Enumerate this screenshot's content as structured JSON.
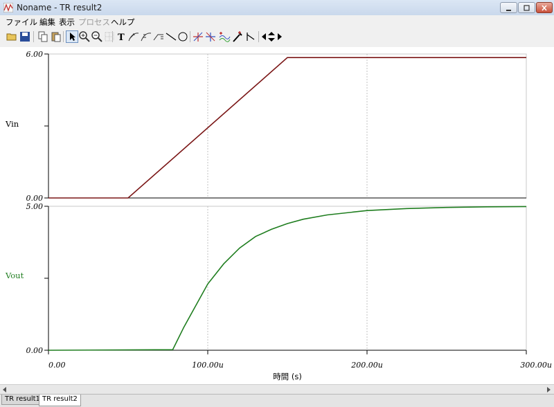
{
  "window": {
    "title": "Noname - TR result2",
    "icon": "app-waveform-icon"
  },
  "menu": [
    {
      "label": "ファイル",
      "enabled": true
    },
    {
      "label": "編集",
      "enabled": true
    },
    {
      "label": "表示",
      "enabled": true
    },
    {
      "label": "プロセス",
      "enabled": false
    },
    {
      "label": "ヘルプ",
      "enabled": true
    }
  ],
  "toolbar": {
    "icons": [
      "open-folder-icon",
      "save-disk-icon",
      "copy-icon",
      "paste-icon",
      "grid-icon",
      "pointer-icon",
      "zoom-in-icon",
      "zoom-fit-icon",
      "text-icon",
      "measure-icon",
      "measure-diff-icon",
      "measure-slope-icon",
      "line-icon",
      "circle-icon",
      "marker-a-icon",
      "marker-b-icon",
      "add-trace-icon",
      "probe-icon",
      "cursor-icon",
      "scroll-left-icon",
      "scroll-updown-icon",
      "scroll-right-icon"
    ]
  },
  "chart_data": [
    {
      "type": "line",
      "ylabel": "Vin",
      "ylim": [
        0,
        6
      ],
      "ytick_labels": [
        "6.00",
        "0.00"
      ],
      "color": "#7a1515",
      "series": [
        {
          "x": [
            0,
            50,
            150,
            300
          ],
          "y": [
            0,
            0,
            5.85,
            5.85
          ]
        }
      ]
    },
    {
      "type": "line",
      "ylabel": "Vout",
      "ylim": [
        0,
        5
      ],
      "ytick_labels": [
        "5.00",
        "0.00"
      ],
      "color": "#1e7d1e",
      "xlabel": "時間 (s)",
      "x_tick_labels": [
        "0.00",
        "100.00u",
        "200.00u",
        "300.00u"
      ],
      "xlim": [
        0,
        300
      ],
      "series": [
        {
          "x": [
            0,
            78,
            85,
            90,
            100,
            110,
            120,
            130,
            140,
            150,
            160,
            175,
            200,
            225,
            250,
            275,
            300
          ],
          "y": [
            0,
            0.02,
            0.8,
            1.3,
            2.3,
            3.0,
            3.55,
            3.95,
            4.2,
            4.4,
            4.55,
            4.7,
            4.85,
            4.92,
            4.96,
            4.98,
            4.99
          ]
        }
      ]
    }
  ],
  "tabs": [
    {
      "label": "TR result1",
      "active": false
    },
    {
      "label": "TR result2",
      "active": true
    }
  ]
}
